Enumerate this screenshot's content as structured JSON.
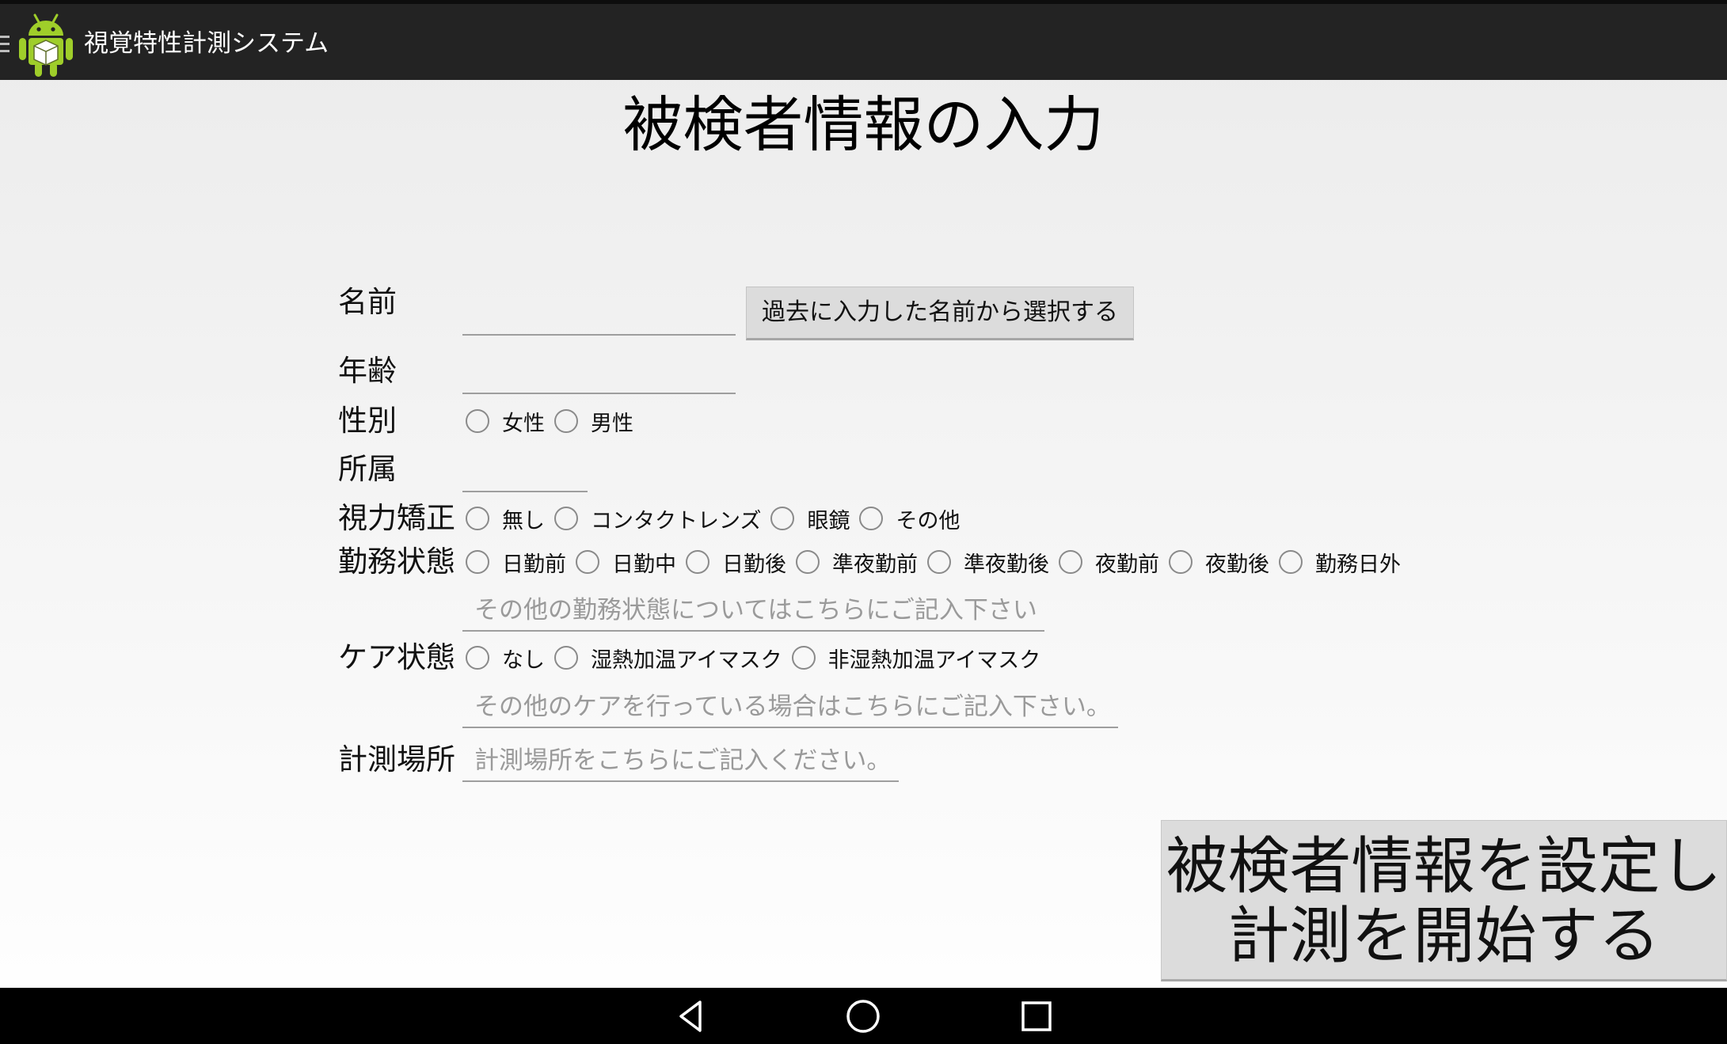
{
  "app": {
    "title": "視覚特性計測システム"
  },
  "page": {
    "title": "被検者情報の入力"
  },
  "form": {
    "name": {
      "label": "名前",
      "value": "",
      "select_button": "過去に入力した名前から選択する"
    },
    "age": {
      "label": "年齢",
      "value": ""
    },
    "gender": {
      "label": "性別",
      "options": [
        "女性",
        "男性"
      ]
    },
    "affiliation": {
      "label": "所属",
      "value": ""
    },
    "vision_correction": {
      "label": "視力矯正",
      "options": [
        "無し",
        "コンタクトレンズ",
        "眼鏡",
        "その他"
      ]
    },
    "work_status": {
      "label": "勤務状態",
      "options": [
        "日勤前",
        "日勤中",
        "日勤後",
        "準夜勤前",
        "準夜勤後",
        "夜勤前",
        "夜勤後",
        "勤務日外"
      ],
      "other_placeholder": "その他の勤務状態についてはこちらにご記入下さい"
    },
    "care_status": {
      "label": "ケア状態",
      "options": [
        "なし",
        "湿熱加温アイマスク",
        "非湿熱加温アイマスク"
      ],
      "other_placeholder": "その他のケアを行っている場合はこちらにご記入下さい。"
    },
    "location": {
      "label": "計測場所",
      "placeholder": "計測場所をこちらにご記入ください。"
    }
  },
  "start_button": {
    "line1": "被検者情報を設定し",
    "line2": "計測を開始する"
  },
  "navbar": {
    "icons": [
      "back-icon",
      "home-icon",
      "recents-icon"
    ]
  }
}
